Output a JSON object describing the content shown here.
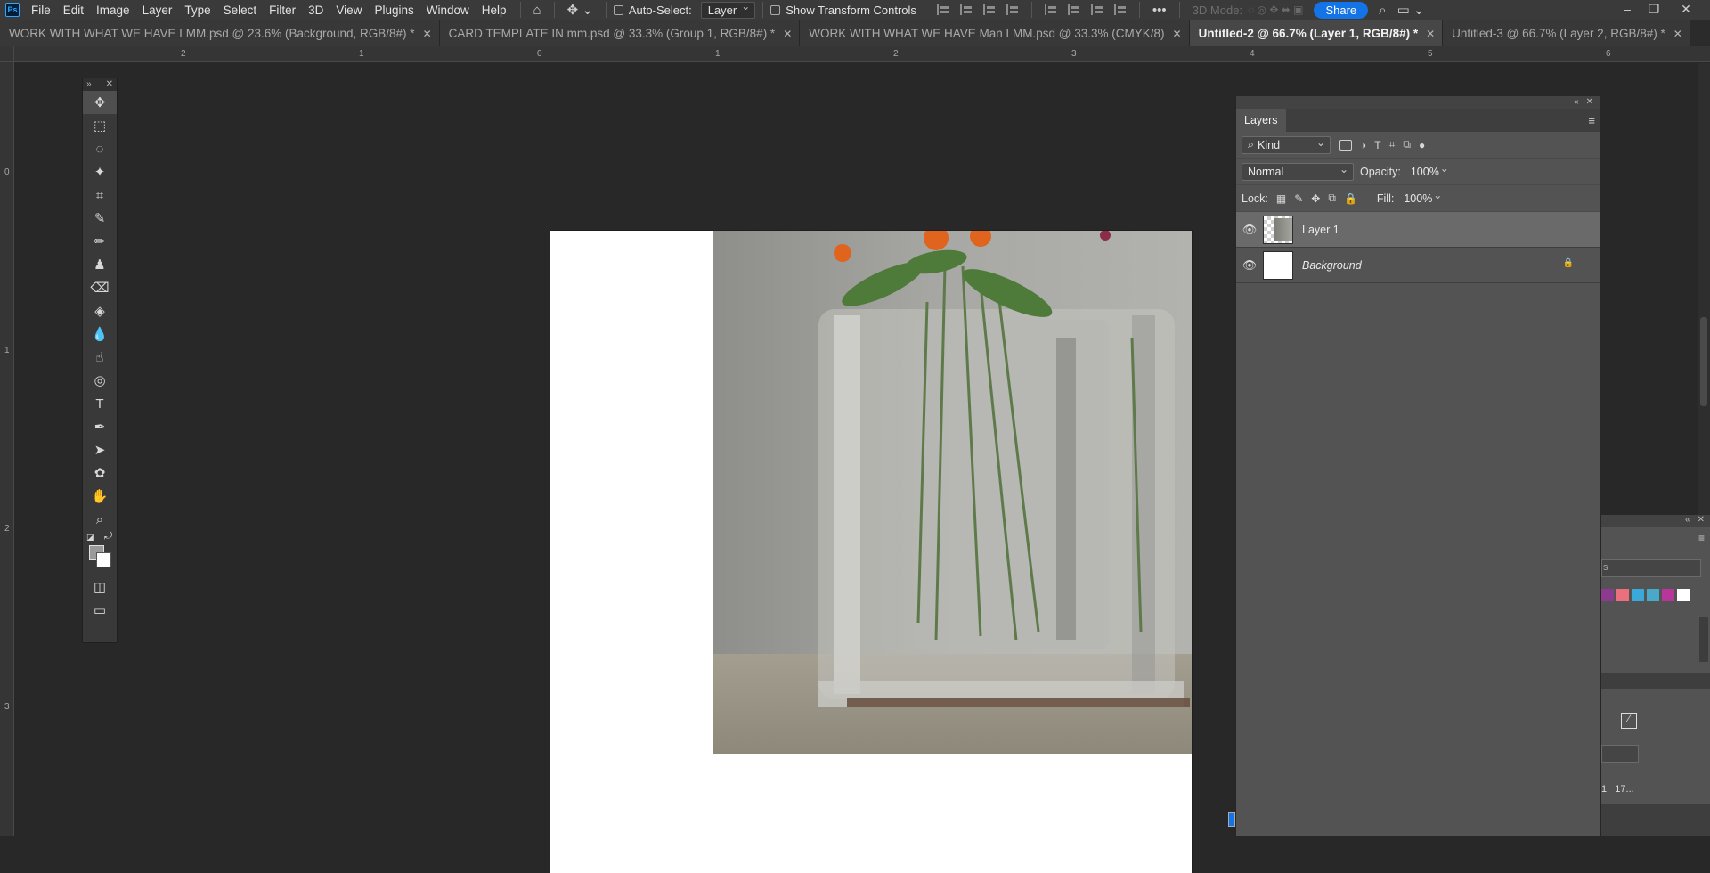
{
  "app": {
    "logo": "Ps"
  },
  "menu": [
    "File",
    "Edit",
    "Image",
    "Layer",
    "Type",
    "Select",
    "Filter",
    "3D",
    "View",
    "Plugins",
    "Window",
    "Help"
  ],
  "options_bar": {
    "auto_select_label": "Auto-Select:",
    "auto_select_value": "Layer",
    "show_transform_label": "Show Transform Controls",
    "more": "•••",
    "mode_3d": "3D Mode:",
    "share": "Share"
  },
  "tabs": [
    {
      "label": "WORK WITH WHAT WE HAVE LMM.psd @ 23.6% (Background, RGB/8#) *",
      "active": false
    },
    {
      "label": "CARD TEMPLATE IN mm.psd @ 33.3% (Group 1, RGB/8#) *",
      "active": false
    },
    {
      "label": "WORK WITH WHAT WE HAVE Man LMM.psd @ 33.3% (CMYK/8)",
      "active": false
    },
    {
      "label": "Untitled-2 @ 66.7% (Layer 1, RGB/8#) *",
      "active": true
    },
    {
      "label": "Untitled-3 @ 66.7% (Layer 2, RGB/8#) *",
      "active": false
    }
  ],
  "rulers": {
    "top": [
      "2",
      "1",
      "0",
      "1",
      "2",
      "3",
      "4",
      "5",
      "6"
    ],
    "left": [
      "0",
      "1",
      "2",
      "3"
    ]
  },
  "layers_panel": {
    "tab": "Layers",
    "filter_kind": "Kind",
    "blend_mode": "Normal",
    "opacity_label": "Opacity:",
    "opacity_value": "100%",
    "lock_label": "Lock:",
    "fill_label": "Fill:",
    "fill_value": "100%",
    "layers": [
      {
        "name": "Layer 1",
        "selected": true,
        "visible": true,
        "locked": false
      },
      {
        "name": "Background",
        "selected": false,
        "visible": true,
        "locked": true
      }
    ]
  },
  "right_partial": {
    "search_fragment": "s",
    "bottom_fragment": "1   17..."
  },
  "colors": {
    "accent": "#1473e6",
    "swatches": [
      "#8b3a8f",
      "#e9707c",
      "#3aa8d8",
      "#4aa8c8",
      "#b8369a",
      "#ffffff"
    ]
  }
}
